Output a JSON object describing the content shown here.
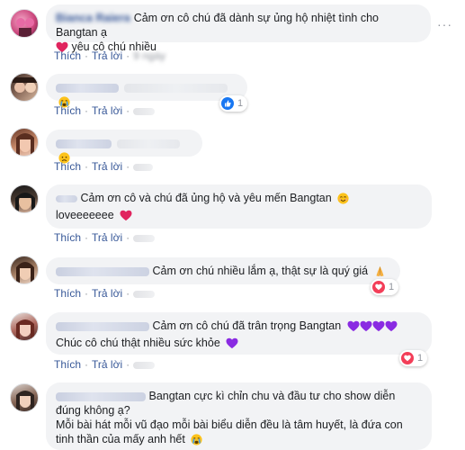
{
  "actions": {
    "like": "Thích",
    "reply": "Trả lời",
    "separator": "·"
  },
  "comments": [
    {
      "author": "Bianca Raiera",
      "text": "Cảm ơn cô chú đã dành sự ủng hộ nhiệt tình cho Bangtan ạ",
      "text_tail": "yêu cô chú nhiều",
      "emoji_inline": "red-heart",
      "time": "9 ngày",
      "reaction": null
    },
    {
      "author": "",
      "text": "",
      "emoji_inline": "crying-face",
      "reaction": {
        "type": "like",
        "count": "1"
      }
    },
    {
      "author": "",
      "text": "",
      "emoji_inline": "sad-face",
      "reaction": null
    },
    {
      "author": "",
      "text": "Cảm ơn cô và chú đã ủng hộ và yêu mến Bangtan",
      "text_tail": "loveeeeeee",
      "emoji_inline": "smiling-face",
      "emoji_tail": "red-heart",
      "reaction": null
    },
    {
      "author": "",
      "text": "Cảm ơn chú nhiều lắm ạ, thật sự là quý giá",
      "emoji_inline": "folded-hands",
      "reaction": {
        "type": "love",
        "count": "1"
      }
    },
    {
      "author": "",
      "text": "Cảm ơn cô chú đã trân trọng Bangtan",
      "text_tail": "Chúc cô chú thật nhiều sức khỏe",
      "emoji_inline": "purple-hearts",
      "emoji_tail": "purple-heart",
      "reaction": {
        "type": "love",
        "count": "1"
      }
    },
    {
      "author": "",
      "text": "Bangtan cực kì chỉn chu và đầu tư cho show diễn đúng không ạ?",
      "text_tail": "Mỗi bài hát mỗi vũ đạo mỗi bài biểu diễn đều là tâm huyết, là đứa con tinh thần của mấy anh hết",
      "emoji_inline": "crying-face",
      "reaction": null
    }
  ],
  "colors": {
    "link": "#385898",
    "bubble": "#f2f3f5",
    "heart": "#e0245e",
    "purple": "#8a2be2",
    "like_blue": "#1877f2",
    "love_red": "#f33e58"
  }
}
